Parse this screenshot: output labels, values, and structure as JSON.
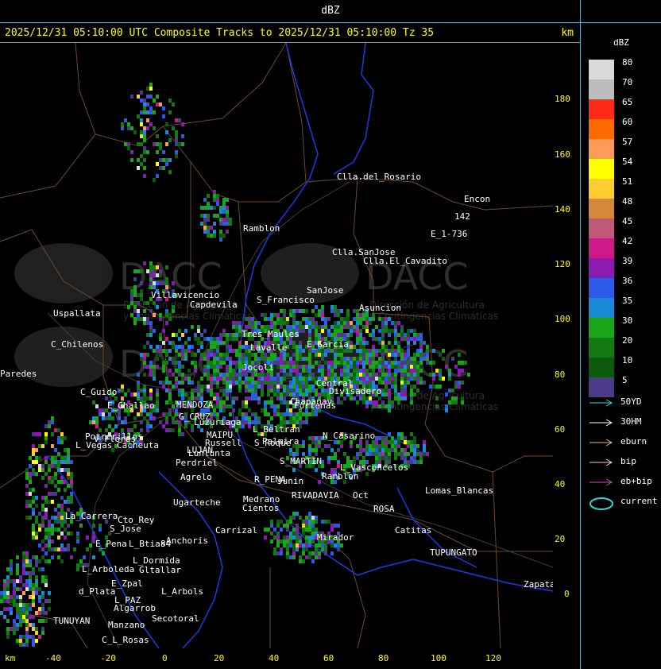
{
  "header": {
    "unit_label": "dBZ"
  },
  "title": {
    "text": "2025/12/31 05:10:00 UTC Composite Tracks to 2025/12/31 05:10:00 Tz 35",
    "km": "km"
  },
  "axes": {
    "y_ticks": [
      "180",
      "160",
      "140",
      "120",
      "100",
      "80",
      "60",
      "40",
      "20",
      "0"
    ],
    "x_ticks": [
      "-40",
      "-20",
      "0",
      "20",
      "40",
      "60",
      "80",
      "100",
      "120"
    ],
    "x_unit": "km"
  },
  "legend": {
    "title": "dBZ",
    "levels": [
      {
        "label": "80",
        "color": "#d9d9d9"
      },
      {
        "label": "70",
        "color": "#bdbdbd"
      },
      {
        "label": "65",
        "color": "#ff2a1a"
      },
      {
        "label": "60",
        "color": "#ff6a00"
      },
      {
        "label": "57",
        "color": "#ff9a5a"
      },
      {
        "label": "54",
        "color": "#ffff00"
      },
      {
        "label": "51",
        "color": "#ffcc33"
      },
      {
        "label": "48",
        "color": "#d4883a"
      },
      {
        "label": "45",
        "color": "#c05878"
      },
      {
        "label": "42",
        "color": "#cc1a8a"
      },
      {
        "label": "39",
        "color": "#8a1ab0"
      },
      {
        "label": "36",
        "color": "#2a5ae6"
      },
      {
        "label": "35",
        "color": "#1a8ad8"
      },
      {
        "label": "30",
        "color": "#1aa51a"
      },
      {
        "label": "20",
        "color": "#137a13"
      },
      {
        "label": "10",
        "color": "#0d5a0d"
      },
      {
        "label": "5",
        "color": "#4b3a8a"
      }
    ],
    "tracks": [
      {
        "name": "50YD",
        "color": "#33d6d6"
      },
      {
        "name": "30HM",
        "color": "#ffffff"
      },
      {
        "name": "eburn",
        "color": "#e8b878"
      },
      {
        "name": "bip",
        "color": "#ffc8d8"
      },
      {
        "name": "eb+bip",
        "color": "#d04ad0"
      },
      {
        "name": "current",
        "color": "#33d6d6"
      }
    ]
  },
  "watermark": {
    "brand": "DACC",
    "line1": "Dirección de Agricultura",
    "line2": "y Contingencias Climáticas"
  },
  "places": [
    {
      "name": "Clla.del_Rosario"
    },
    {
      "name": "Encon"
    },
    {
      "name": "142"
    },
    {
      "name": "E_1-736"
    },
    {
      "name": "Ramblon"
    },
    {
      "name": "Clla.SanJose"
    },
    {
      "name": "Clla.El_Cavadito"
    },
    {
      "name": "Villavicencio"
    },
    {
      "name": "Capdevila"
    },
    {
      "name": "S_Francisco"
    },
    {
      "name": "SanJose"
    },
    {
      "name": "Asuncion"
    },
    {
      "name": "Uspallata"
    },
    {
      "name": "Tres_Maules"
    },
    {
      "name": "C_Chilenos"
    },
    {
      "name": "Lavalle"
    },
    {
      "name": "E_Garcia"
    },
    {
      "name": "Paredes"
    },
    {
      "name": "Jocoli"
    },
    {
      "name": "Central"
    },
    {
      "name": "C_Guido"
    },
    {
      "name": "MENDOZA"
    },
    {
      "name": "E_Challao"
    },
    {
      "name": "G_CRUZ"
    },
    {
      "name": "Divisadero"
    },
    {
      "name": "Fortenas"
    },
    {
      "name": "Luzuriaga"
    },
    {
      "name": "Chapanay"
    },
    {
      "name": "Potrerillos"
    },
    {
      "name": "L_Vegas"
    },
    {
      "name": "Cacheuta"
    },
    {
      "name": "MAIPU"
    },
    {
      "name": "Russell"
    },
    {
      "name": "L_Beltran"
    },
    {
      "name": "Palmira"
    },
    {
      "name": "N_Casarino"
    },
    {
      "name": "S_Roque"
    },
    {
      "name": "LUJAN"
    },
    {
      "name": "Lunlunta"
    },
    {
      "name": "Perdriel"
    },
    {
      "name": "S_MARTIN"
    },
    {
      "name": "Ramblon"
    },
    {
      "name": "Agrelo"
    },
    {
      "name": "L_Vasconcelos"
    },
    {
      "name": "R_PENA"
    },
    {
      "name": "Junin"
    },
    {
      "name": "Ugarteche"
    },
    {
      "name": "Medrano"
    },
    {
      "name": "RIVADAVIA"
    },
    {
      "name": "Oct"
    },
    {
      "name": "Lomas_Blancas"
    },
    {
      "name": "La_Carrera"
    },
    {
      "name": "Cto_Rey"
    },
    {
      "name": "S_Jose"
    },
    {
      "name": "Carrizal"
    },
    {
      "name": "Cientos"
    },
    {
      "name": "ROSA"
    },
    {
      "name": "Catitas"
    },
    {
      "name": "E_Pena"
    },
    {
      "name": "Anchoris"
    },
    {
      "name": "Mirador"
    },
    {
      "name": "L_Btias"
    },
    {
      "name": "TUPUNGATO"
    },
    {
      "name": "L_Dormida"
    },
    {
      "name": "L_Arboleda"
    },
    {
      "name": "Gltallar"
    },
    {
      "name": "E_Zpal"
    },
    {
      "name": "d_Plata"
    },
    {
      "name": "L_Arbols"
    },
    {
      "name": "Zapata"
    },
    {
      "name": "L_PAZ"
    },
    {
      "name": "Algarrob"
    },
    {
      "name": "Secotoral"
    },
    {
      "name": "TUNUYAN"
    },
    {
      "name": "Manzano"
    },
    {
      "name": "C_L_Rosas"
    },
    {
      "name": "V_Flores"
    },
    {
      "name": "84"
    },
    {
      "name": "88"
    }
  ]
}
